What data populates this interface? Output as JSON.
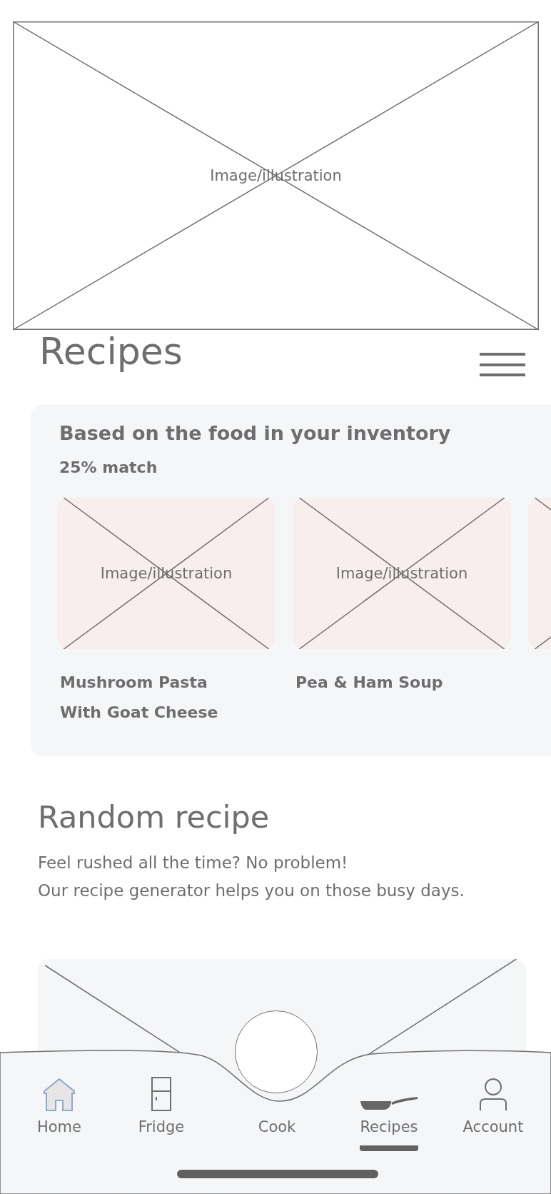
{
  "hero": {
    "label": "Image/illustration"
  },
  "title": "Recipes",
  "inventory": {
    "heading": "Based on the food in your inventory",
    "match": "25% match",
    "recipes": [
      {
        "kind": "recipe",
        "image_label": "Image/illustration",
        "title": "Mushroom Pasta\nWith Goat Cheese"
      },
      {
        "kind": "recipe",
        "image_label": "Image/illustration",
        "title": "Pea & Ham Soup"
      },
      {
        "kind": "placeholder"
      }
    ]
  },
  "random": {
    "heading": "Random recipe",
    "text": "Feel rushed all the time? No problem!\nOur recipe generator helps you on those busy days."
  },
  "nav": [
    {
      "kind": "home",
      "label": "Home",
      "selected": false
    },
    {
      "kind": "fridge",
      "label": "Fridge",
      "selected": false
    },
    {
      "kind": "cook",
      "label": "Cook",
      "selected": false
    },
    {
      "kind": "recipes",
      "label": "Recipes",
      "selected": true
    },
    {
      "kind": "account",
      "label": "Account",
      "selected": false
    }
  ]
}
